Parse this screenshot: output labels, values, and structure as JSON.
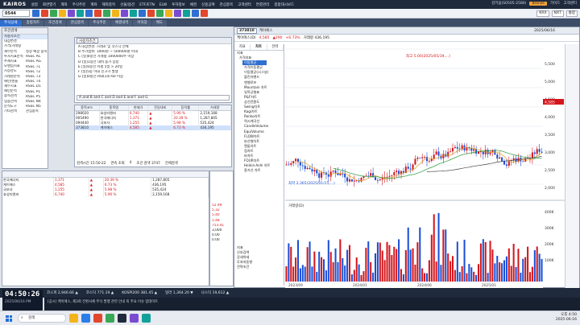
{
  "app": {
    "logo": "KAIROS",
    "menu": [
      "설정",
      "화면열기",
      "계좌",
      "주식주문",
      "계좌",
      "해외종목",
      "선물/옵션",
      "ETF/ETN",
      "ELW",
      "투자정보",
      "채권",
      "신용공여",
      "관심종목",
      "고객센터",
      "연결관리",
      "종합대시보드"
    ],
    "status_right": [
      "김키움(S0505-2580)",
      "Bronze",
      "가이드",
      "고객센터"
    ]
  },
  "toolbar": {
    "account": "0544",
    "right_tags": [
      "KRX",
      "NXT",
      "통합"
    ]
  },
  "tabs": [
    "주식상세",
    "종합차트",
    "조건검색",
    "관심종목",
    "주식주문",
    "체결내역",
    "이익장",
    "매도"
  ],
  "left_tree": {
    "header": "조건검색",
    "search_label": "사용자조건",
    "items": [
      {
        "label": "사용자조건",
        "level": 0
      },
      {
        "label": "대상변경",
        "level": 0
      },
      {
        "label": "가격/거래량",
        "level": 0
      },
      {
        "label": "재무분석",
        "level": 0
      },
      {
        "label": "투자지표분석",
        "level": 0
      },
      {
        "label": "추세지표",
        "level": 0
      },
      {
        "label": "모멘텀지표",
        "level": 0
      },
      {
        "label": "시장강도",
        "level": 0
      },
      {
        "label": "거래원분석",
        "level": 0
      },
      {
        "label": "패턴/캔들",
        "level": 0
      },
      {
        "label": "재무지표",
        "level": 0
      },
      {
        "label": "패턴분석",
        "level": 0
      },
      {
        "label": "종목검색",
        "level": 0
      },
      {
        "label": "업종선택",
        "level": 0
      },
      {
        "label": "분석도구",
        "level": 0
      },
      {
        "label": "기타검색",
        "level": 0
      }
    ],
    "sub_items": [
      "성장 예상 종목",
      "RSSC AC",
      "RSSC AG",
      "RSSC T1",
      "RSSC T2",
      "RSSC T3",
      "RSSC T4",
      "RSSC D1",
      "RSSC P1",
      "RSSC P5",
      "RSSC N4",
      "RSSC N5",
      "관심종목"
    ]
  },
  "condition": {
    "formula": "A and B and C and D and E and F and G",
    "lines": [
      "A  대상변경: 거래소 및 코스닥 전체",
      "B  주가범위: 1000원 ~ 500000원 이내",
      "C  [일]0봉전 거래량 1000000주 이상",
      "D  [일]1봉전 대비 종가 상승",
      "E  [일]0봉전 이평 5일 > 20일",
      "F  [일]5봉 이내 신고가 발생",
      "G  [일]0봉전 RSI(14) 60 이상"
    ]
  },
  "result_table": {
    "headers": [
      "종목코드",
      "종목명",
      "현재가",
      "전일대비",
      "등락률",
      "거래량"
    ],
    "rows": [
      [
        "298020",
        "효성티앤씨",
        "6,740",
        "▲",
        "5.90 %",
        "2,159,168"
      ],
      [
        "005490",
        "한국에너지",
        "1,371",
        "▲",
        "20.39 %",
        "1,287,805"
      ],
      [
        "094440",
        "국보사",
        "1,255",
        "▲",
        "5.98 %",
        "535,424"
      ],
      [
        "373810",
        "케이에스",
        "4,585",
        "▲",
        "6.73 %",
        "436,195"
      ]
    ],
    "selected_row": 3,
    "footer": [
      "검색시간 15:50:22",
      "연속 조회",
      "4",
      "조건 검색 3747",
      "전체검색"
    ]
  },
  "watch_table": {
    "rows": [
      [
        "한국에너지",
        "1,371",
        "▲",
        "20.39 %",
        "1,287,805"
      ],
      [
        "케이에스",
        "4,585",
        "▲",
        "6.73 %",
        "436,195"
      ],
      [
        "국보사",
        "1,255",
        "▲",
        "5.98 %",
        "535,424"
      ],
      [
        "효성티앤씨",
        "6,740",
        "▲",
        "5.90 %",
        "2,159,168"
      ]
    ]
  },
  "order_panel": {
    "quote_prices": [
      "52.99",
      "5.32",
      "5.40",
      "5.48",
      "753.41"
    ],
    "values": [
      "3,000",
      "0.00",
      "0.00"
    ]
  },
  "chart_window": {
    "code": "373810",
    "name": "케이에스",
    "date_label": "2025/06/16",
    "info": [
      "케이에스(D)",
      "4,585",
      "▲290",
      "+6.73%",
      "거래량 436,195"
    ],
    "indicator_tabs": [
      "지표",
      "차트",
      "전략"
    ],
    "indicator_header": "지표",
    "indicator_group": "가격지표",
    "indicator_selected": "이동평균",
    "indicators": [
      "가격이동평균",
      "이동평균(시그널)",
      "볼린저밴드",
      "엔벨로프",
      "Mountain 차트",
      "일목균형표",
      "P&F차트",
      "삼선전환도",
      "Swing차트",
      "Kagi차트",
      "Renko차트",
      "역시계곡선",
      "CandleVolume",
      "EquiVolume",
      "FLOW차트",
      "분산형차트",
      "캔들차트",
      "점차트",
      "바차트",
      "FOUR차트",
      "Heikin-Ashi 차트",
      "종가선 차트"
    ],
    "bottom_groups": [
      "지표",
      "신호검색",
      "강세약세",
      "투자자동향",
      "전략조건"
    ],
    "annotations": [
      "최고 5.00(2025/05/19,...)",
      "최저 2,365(2025/01/15,...)"
    ],
    "volume_label": "거래량(D)"
  },
  "chart_data": {
    "type": "candlestick",
    "title": "케이에스(D)",
    "price_axis": [
      "5,500",
      "5,000",
      "4,500",
      "4,000",
      "3,500",
      "3,000",
      "2,500",
      "2,000"
    ],
    "volume_axis": [
      "400K",
      "300K",
      "200K",
      "100K"
    ],
    "date_ticks": [
      "2023/09",
      "2024/01",
      "2024/06",
      "2025/01"
    ],
    "last_close": 4585,
    "last_price_label": "4,585"
  },
  "status": {
    "clock": "04:50:26",
    "date": "2025/06/16 PM",
    "tray_time": "오후 4:50",
    "tray_date": "2025-06-16"
  },
  "ticker": {
    "items": [
      "코스피 2,946.66 ▲",
      "코스닥 771.19 ▲",
      "KOSPI200 381.45 ▲",
      "달러 1,364.20 ▼",
      "나스닥 19,612 ▲"
    ],
    "news": "[공시] 케이에스, 제3회 전환사채 주식 발행 관련 안내 외 주요 이슈 업데이트"
  },
  "taskbar": {
    "search": "검색"
  }
}
